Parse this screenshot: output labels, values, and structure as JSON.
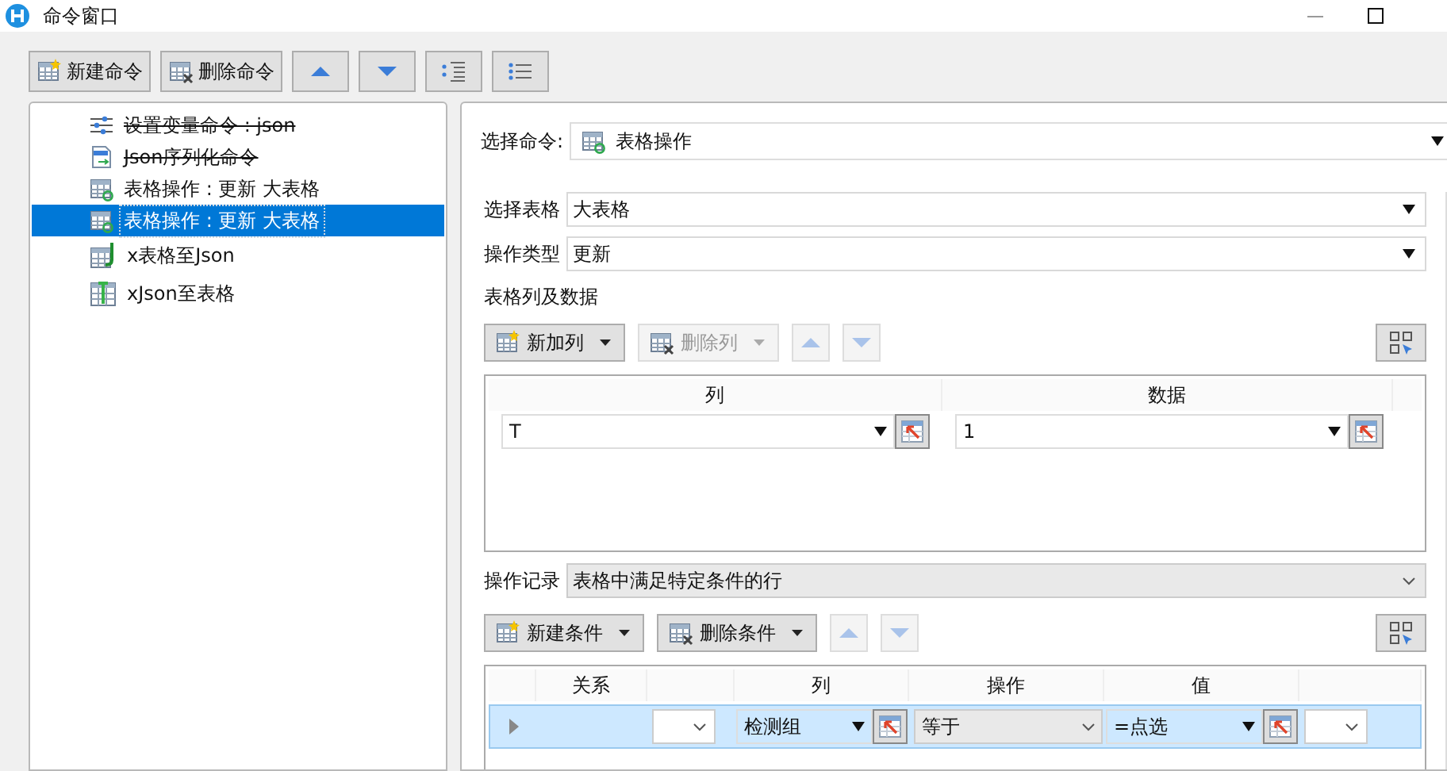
{
  "window": {
    "title": "命令窗口"
  },
  "toolbar": [
    {
      "kind": "new",
      "label": "新建命令"
    },
    {
      "kind": "delete",
      "label": "删除命令"
    },
    {
      "kind": "up"
    },
    {
      "kind": "down"
    },
    {
      "kind": "indent"
    },
    {
      "kind": "list"
    }
  ],
  "commands": [
    {
      "kind": "variable",
      "label": "设置变量命令 : json",
      "struck": true,
      "selected": false
    },
    {
      "kind": "json",
      "label": "Json序列化命令",
      "struck": true,
      "selected": false
    },
    {
      "kind": "table",
      "label": "表格操作 : 更新 大表格",
      "struck": false,
      "selected": false
    },
    {
      "kind": "table",
      "label": "表格操作 : 更新 大表格",
      "struck": false,
      "selected": true
    },
    {
      "kind": "to-json",
      "label": "x表格至Json",
      "struck": false,
      "selected": false
    },
    {
      "kind": "from-json",
      "label": "xJson至表格",
      "struck": false,
      "selected": false
    }
  ],
  "select_command": {
    "label": "选择命令:",
    "value": "表格操作"
  },
  "fields": [
    {
      "label": "选择表格",
      "value": "大表格"
    },
    {
      "label": "操作类型",
      "value": "更新"
    }
  ],
  "section_label": "表格列及数据",
  "column_buttons": [
    {
      "label": "新加列",
      "disabled": false
    },
    {
      "label": "删除列",
      "disabled": true
    }
  ],
  "columns_table": {
    "headers": [
      "列",
      "数据"
    ],
    "rows": [
      {
        "column": "T",
        "data": "1"
      }
    ]
  },
  "record": {
    "label": "操作记录",
    "value": "表格中满足特定条件的行"
  },
  "condition_buttons": [
    {
      "label": "新建条件",
      "disabled": false
    },
    {
      "label": "删除条件",
      "disabled": false
    }
  ],
  "conditions_table": {
    "headers": {
      "relation": "关系",
      "column": "列",
      "operation": "操作",
      "value": "值"
    },
    "rows": [
      {
        "column": "检测组",
        "operation": "等于",
        "value": "=点选",
        "selected": true
      }
    ]
  }
}
